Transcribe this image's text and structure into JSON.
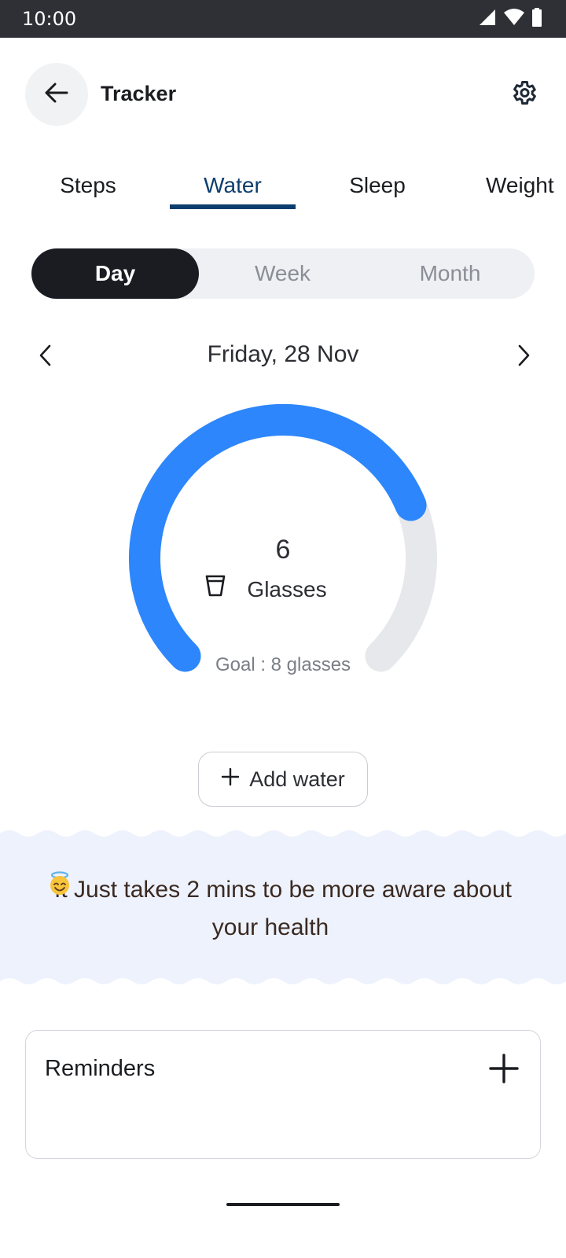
{
  "status_bar": {
    "time": "10:00"
  },
  "header": {
    "title": "Tracker"
  },
  "tabs": [
    {
      "label": "Steps"
    },
    {
      "label": "Water"
    },
    {
      "label": "Sleep"
    },
    {
      "label": "Weight"
    }
  ],
  "active_tab": "Water",
  "period": {
    "options": [
      "Day",
      "Week",
      "Month"
    ],
    "selected": "Day"
  },
  "date": {
    "label": "Friday, 28 Nov"
  },
  "intake": {
    "value": "6",
    "unit_label": "Glasses",
    "goal_label": "Goal : 8 glasses",
    "progress_fraction": 0.75
  },
  "add_water": {
    "label": "Add water"
  },
  "banner": {
    "text": "It Just takes 2 mins to be more aware about your health"
  },
  "reminders": {
    "title": "Reminders"
  },
  "colors": {
    "accent": "#2d86fb",
    "track": "#e7e8ec",
    "tab_active": "#0b3d6e",
    "banner_bg": "#eef2fd",
    "segment_active_bg": "#1a1c22"
  },
  "icons": {
    "back": "arrow-left-icon",
    "settings": "gear-icon",
    "prev": "chevron-left-icon",
    "next": "chevron-right-icon",
    "glass": "glass-icon",
    "add": "plus-icon",
    "emoji": "smiling-face-with-halo"
  }
}
